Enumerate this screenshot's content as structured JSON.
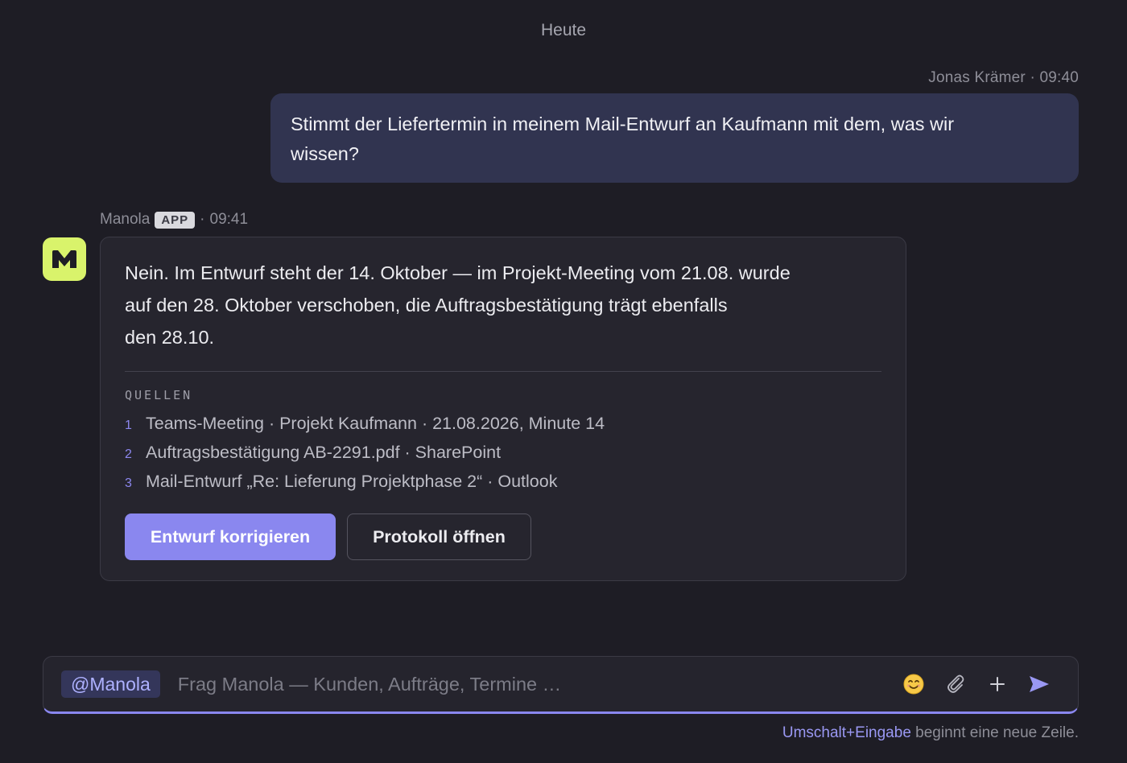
{
  "date_divider": "Heute",
  "user_message": {
    "author": "Jonas Krämer",
    "time": "09:40",
    "text_line1": "Stimmt der Liefertermin in meinem Mail-Entwurf an Kaufmann mit dem, was wir",
    "text_line2": "wissen?"
  },
  "bot_message": {
    "author": "Manola",
    "badge": "APP",
    "time": "09:41",
    "answer_lines": [
      "Nein. Im Entwurf steht der 14. Oktober — im Projekt-Meeting vom 21.08. wurde",
      "auf den 28. Oktober verschoben, die Auftragsbestätigung trägt ebenfalls",
      "den 28.10."
    ],
    "sources_title": "QUELLEN",
    "sources": [
      {
        "num": "1",
        "text": "Teams-Meeting · Projekt Kaufmann · 21.08.2026, Minute 14"
      },
      {
        "num": "2",
        "text": "Auftragsbestätigung AB-2291.pdf · SharePoint"
      },
      {
        "num": "3",
        "text": "Mail-Entwurf „Re: Lieferung Projektphase 2“ · Outlook"
      }
    ],
    "primary_action": "Entwurf korrigieren",
    "secondary_action": "Protokoll öffnen"
  },
  "composer": {
    "mention": "@Manola",
    "placeholder": "Frag Manola — Kunden, Aufträge, Termine …",
    "icons": [
      "emoji-icon",
      "paperclip-icon",
      "plus-icon",
      "send-icon"
    ]
  },
  "hint": {
    "key": "Umschalt+Eingabe",
    "text": "beginnt eine neue Zeile."
  },
  "colors": {
    "background": "#1e1d25",
    "accent": "#8a87ef",
    "avatar": "#d9f36b",
    "user_bubble": "#313450"
  }
}
